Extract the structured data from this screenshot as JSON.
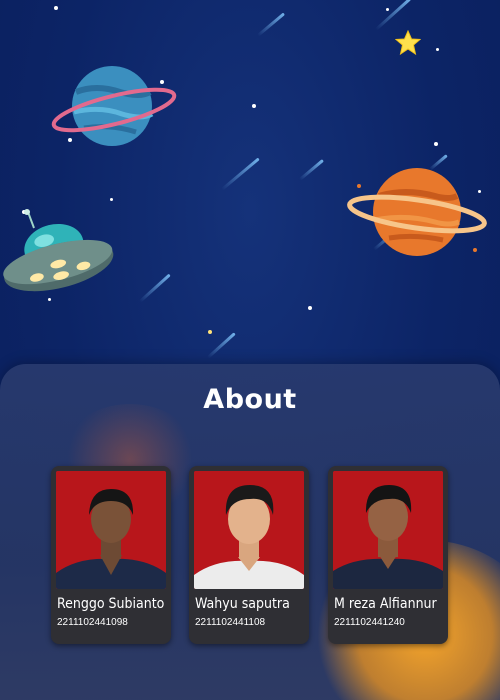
{
  "about": {
    "title": "About",
    "members": [
      {
        "name": "Renggo Subianto",
        "nim": "2211102441098"
      },
      {
        "name": "Wahyu saputra",
        "nim": "2211102441108"
      },
      {
        "name": "M reza Alfiannur",
        "nim": "2211102441240"
      }
    ]
  },
  "colors": {
    "space_background": "#0c2466",
    "panel": "#283a6e",
    "card": "#2f2f34",
    "photo_background": "#b5141a",
    "planet_blue": "#3a8fc0",
    "planet_orange": "#e8782c",
    "glow": "#f29a1f"
  },
  "icons": [
    "blue-planet-icon",
    "orange-planet-icon",
    "ufo-icon",
    "yellow-star-icon",
    "meteor-icon"
  ]
}
